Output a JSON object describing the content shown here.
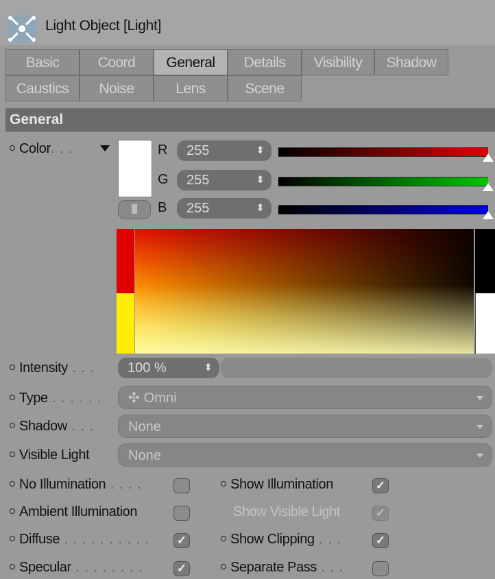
{
  "object": {
    "title": "Light Object [Light]",
    "icon": "light-object-icon"
  },
  "tabs": [
    {
      "label": "Basic"
    },
    {
      "label": "Coord"
    },
    {
      "label": "General",
      "active": true
    },
    {
      "label": "Details"
    },
    {
      "label": "Visibility"
    },
    {
      "label": "Shadow"
    },
    {
      "label": "Caustics"
    },
    {
      "label": "Noise"
    },
    {
      "label": "Lens"
    },
    {
      "label": "Scene"
    }
  ],
  "section": {
    "title": "General"
  },
  "color": {
    "label": "Color",
    "swatch_hex": "#ffffff",
    "channels": [
      {
        "name": "R",
        "value": "255",
        "slider_level": 1.0,
        "color": "#e00000"
      },
      {
        "name": "G",
        "value": "255",
        "slider_level": 1.0,
        "color": "#00c800"
      },
      {
        "name": "B",
        "value": "255",
        "slider_level": 1.0,
        "color": "#0000e0"
      }
    ]
  },
  "intensity": {
    "label": "Intensity",
    "value": "100 %"
  },
  "type": {
    "label": "Type",
    "value": "Omni"
  },
  "shadow": {
    "label": "Shadow",
    "value": "None"
  },
  "visible_light": {
    "label": "Visible Light",
    "value": "None"
  },
  "options": {
    "no_illumination": {
      "label": "No Illumination",
      "checked": false
    },
    "ambient_illumination": {
      "label": "Ambient Illumination",
      "checked": false
    },
    "diffuse": {
      "label": "Diffuse",
      "checked": true
    },
    "specular": {
      "label": "Specular",
      "checked": true
    },
    "show_illumination": {
      "label": "Show Illumination",
      "checked": true
    },
    "show_visible_light": {
      "label": "Show Visible Light",
      "checked": true,
      "disabled": true
    },
    "show_clipping": {
      "label": "Show Clipping",
      "checked": true
    },
    "separate_pass": {
      "label": "Separate Pass",
      "checked": false
    }
  },
  "colors": {
    "panel_bg": "#9a9a9a",
    "section_bg": "#6b6b6b",
    "active_tab": "#b3b3b3"
  }
}
